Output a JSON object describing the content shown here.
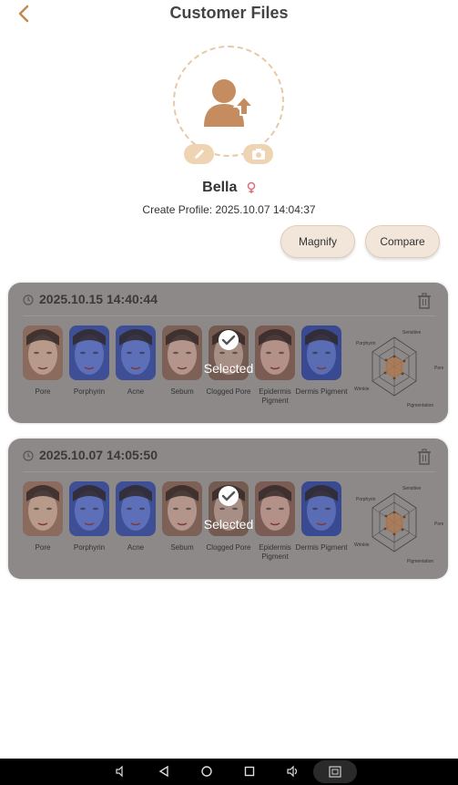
{
  "header": {
    "title": "Customer Files"
  },
  "profile": {
    "name": "Bella",
    "create_label": "Create Profile:",
    "create_value": "2025.10.07  14:04:37"
  },
  "actions": {
    "magnify": "Magnify",
    "compare": "Compare"
  },
  "records": [
    {
      "timestamp": "2025.10.15 14:40:44",
      "selected_overlay_text": "Selected",
      "thumbnails": [
        {
          "label": "Pore"
        },
        {
          "label": "Porphyrin"
        },
        {
          "label": "Acne"
        },
        {
          "label": "Sebum"
        },
        {
          "label": "Clogged Pore"
        },
        {
          "label": "Epidermis Pigment"
        },
        {
          "label": "Dermis Pigment"
        }
      ],
      "radar_labels": {
        "top": "Sensitive",
        "left_top": "Porphyrin",
        "right": "Pore",
        "left": "Wrinkle",
        "bottom": "Pigmentation"
      }
    },
    {
      "timestamp": "2025.10.07 14:05:50",
      "selected_overlay_text": "Selected",
      "thumbnails": [
        {
          "label": "Pore"
        },
        {
          "label": "Porphyrin"
        },
        {
          "label": "Acne"
        },
        {
          "label": "Sebum"
        },
        {
          "label": "Clogged Pore"
        },
        {
          "label": "Epidermis Pigment"
        },
        {
          "label": "Dermis Pigment"
        }
      ],
      "radar_labels": {
        "top": "Sensitive",
        "left_top": "Porphyrin",
        "right": "Pore",
        "left": "Wrinkle",
        "bottom": "Pigmentation"
      }
    }
  ],
  "colors": {
    "accent": "#b9793d",
    "chip": "#efd4b3",
    "card_bg": "#8c8988"
  }
}
